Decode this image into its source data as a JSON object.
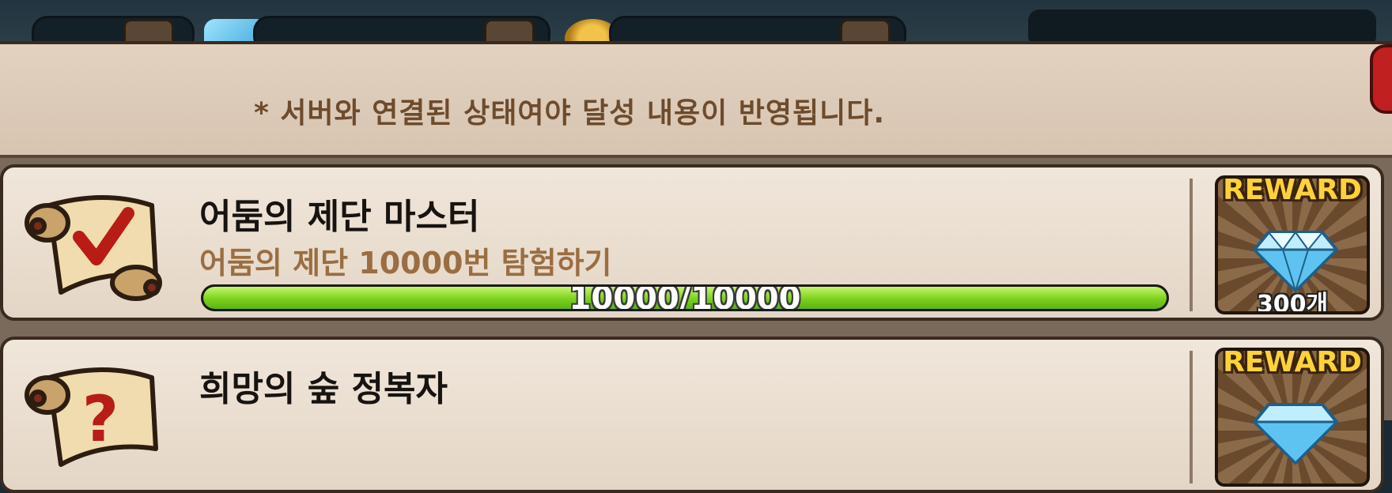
{
  "notice": "* 서버와 연결된 상태여야 달성 내용이 반영됩니다.",
  "achievements": [
    {
      "icon": "scroll-check-icon",
      "title": "어둠의 제단 마스터",
      "description": "어둠의 제단 10000번 탐험하기",
      "progress_text": "10000/10000",
      "progress_fraction": 1.0,
      "reward_label": "REWARD",
      "reward_item_icon": "diamond-icon",
      "reward_quantity": "300개"
    },
    {
      "icon": "scroll-question-icon",
      "title": "희망의 숲 정복자",
      "reward_label": "REWARD",
      "reward_item_icon": "diamond-icon"
    }
  ],
  "colors": {
    "progress_fill": "#7bd21e",
    "reward_label": "#ffd23a",
    "description": "#9a6e42",
    "notice": "#6d4b2c"
  }
}
